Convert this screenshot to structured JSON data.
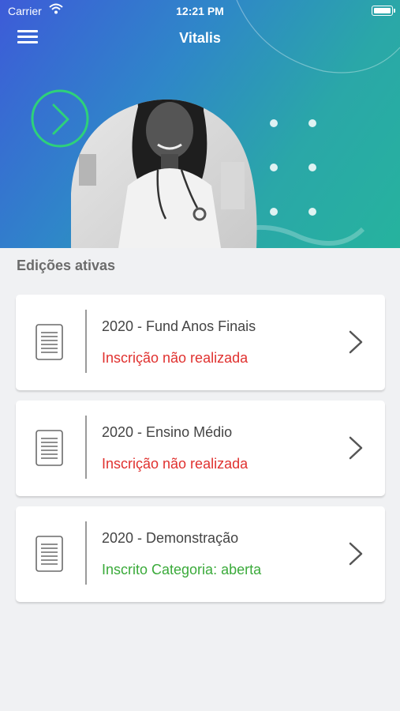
{
  "status_bar": {
    "carrier": "Carrier",
    "time": "12:21 PM"
  },
  "header": {
    "title": "Vitalis",
    "menu_icon": "hamburger-icon"
  },
  "section": {
    "title": "Edições ativas"
  },
  "colors": {
    "not_registered": "#e0312f",
    "registered": "#3aaa3a"
  },
  "editions": [
    {
      "title": "2020 - Fund Anos Finais",
      "status": "Inscrição não realizada",
      "status_type": "not_registered"
    },
    {
      "title": "2020 - Ensino Médio",
      "status": "Inscrição não realizada",
      "status_type": "not_registered"
    },
    {
      "title": "2020 - Demonstração",
      "status": "Inscrito Categoria: aberta",
      "status_type": "registered"
    }
  ]
}
